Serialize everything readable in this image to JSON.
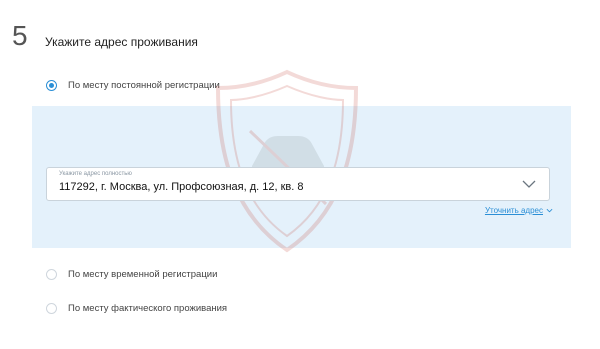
{
  "step": {
    "number": "5",
    "title": "Укажите адрес проживания"
  },
  "options": [
    {
      "label": "По месту постоянной регистрации",
      "checked": true
    },
    {
      "label": "По месту временной регистрации",
      "checked": false
    },
    {
      "label": "По месту фактического проживания",
      "checked": false
    }
  ],
  "address": {
    "caption": "Укажите адрес полностью",
    "value": "117292, г. Москва, ул. Профсоюзная, д. 12, кв. 8"
  },
  "refine_link": "Уточнить адрес",
  "colors": {
    "accent": "#2b8fd6",
    "panel_background": "#e4f1fb"
  },
  "icons": {
    "dropdown": "chevron-down-icon",
    "refine": "chevron-down-icon",
    "watermark": "shield-car-watermark"
  }
}
